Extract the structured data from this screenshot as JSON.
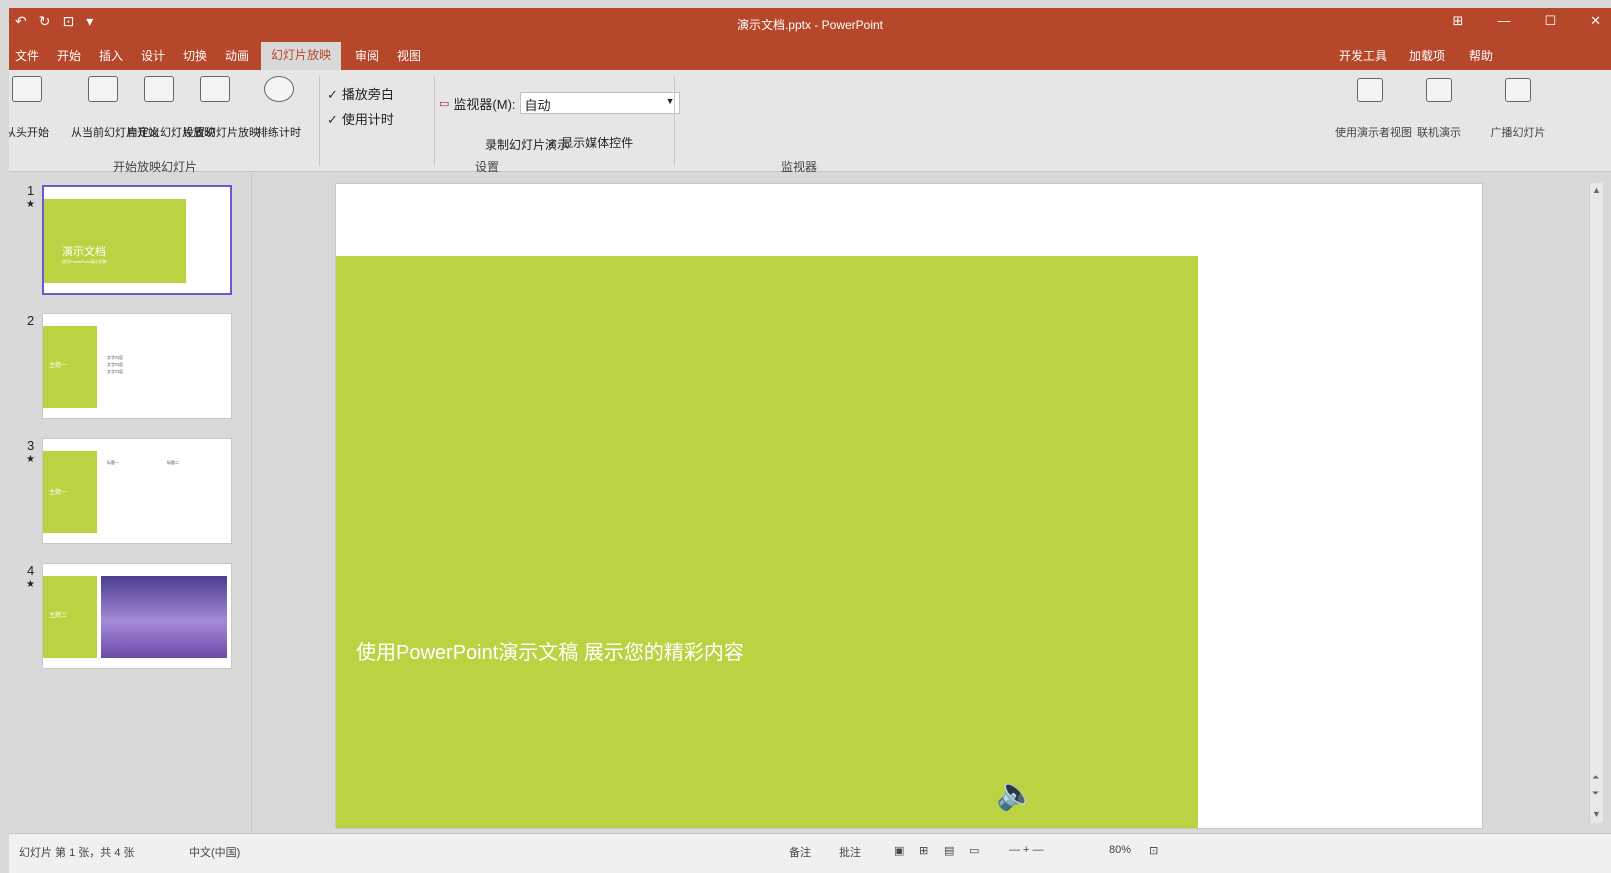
{
  "window": {
    "title": "演示文档.pptx - PowerPoint",
    "qat": {
      "undo_icon": "↶",
      "redo_icon": "↻",
      "present_icon": "⊡",
      "more_icon": "▾"
    },
    "controls": {
      "ribbon_display": "⊞",
      "minimize": "—",
      "maximize": "☐",
      "close": "✕"
    }
  },
  "ribbon": {
    "tabs": [
      "文件",
      "开始",
      "插入",
      "设计",
      "切换",
      "动画",
      "幻灯片放映",
      "审阅",
      "视图"
    ],
    "active_tab": "幻灯片放映",
    "right_tabs": [
      "开发工具",
      "加载项",
      "帮助"
    ],
    "buttons": {
      "from_start": "从头开始",
      "from_current": "从当前幻灯片开始",
      "custom_show": "自定义幻灯片放映",
      "setup_show": "设置幻灯片放映",
      "hide_slide": "隐藏幻灯片",
      "rehearse": "排练计时",
      "record": "录制幻灯片演示"
    },
    "checks": {
      "play_narration": "播放旁白",
      "use_timings": "使用计时",
      "show_media_controls": "显示媒体控件"
    },
    "monitor": {
      "label": "监视器(M):",
      "value": "自动"
    },
    "groups": {
      "start": "开始放映幻灯片",
      "setup": "设置",
      "monitors": "监视器"
    },
    "right_buttons": {
      "presenter_view": "使用演示者视图",
      "present_online": "联机演示",
      "broadcast": "广播幻灯片"
    }
  },
  "thumbnails": [
    {
      "number": "1",
      "title": "演示文档",
      "subtitle": "使用PowerPoint演示文稿"
    },
    {
      "number": "2",
      "title": "主题一",
      "lines": [
        "文字内容",
        "文字内容",
        "文字内容"
      ]
    },
    {
      "number": "3",
      "title": "主题一",
      "lines": [
        "标题一",
        "标题二"
      ]
    },
    {
      "number": "4",
      "title": "主题三"
    }
  ],
  "slide": {
    "title": "演示文档",
    "subtitle": "使用PowerPoint演示文稿 展示您的精彩内容",
    "speaker_icon": "🔈"
  },
  "status": {
    "slide_info": "幻灯片 第 1 张，共 4 张",
    "language": "中文(中国)",
    "notes": "备注",
    "comments": "批注",
    "zoom": "80%"
  },
  "colors": {
    "accent": "#b7472a",
    "slide_green": "#bbd243",
    "selection": "#6a5acd"
  }
}
